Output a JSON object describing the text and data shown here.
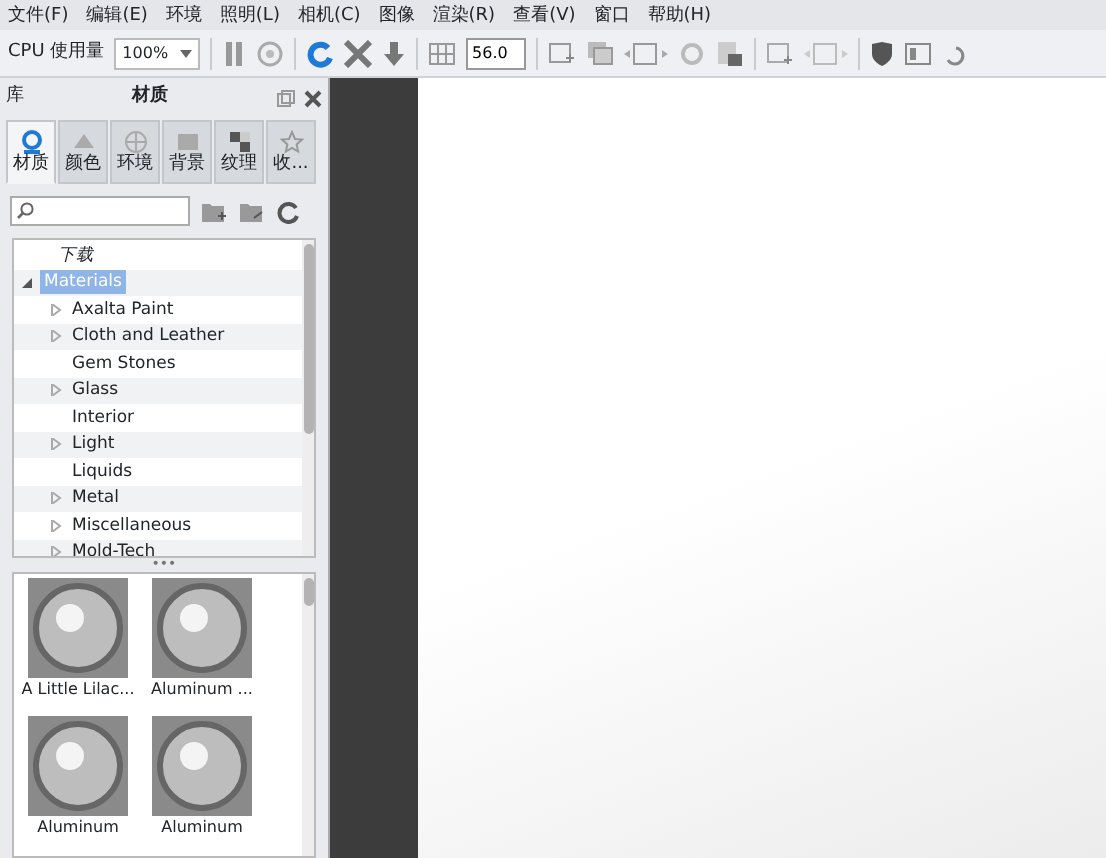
{
  "menu": [
    {
      "label": "文件(F)"
    },
    {
      "label": "编辑(E)"
    },
    {
      "label": "环境"
    },
    {
      "label": "照明(L)"
    },
    {
      "label": "相机(C)"
    },
    {
      "label": "图像"
    },
    {
      "label": "渲染(R)"
    },
    {
      "label": "查看(V)"
    },
    {
      "label": "窗口"
    },
    {
      "label": "帮助(H)"
    }
  ],
  "toolbar": {
    "cpu_label": "CPU 使用量",
    "cpu_select": "100%",
    "number_field": "56.0"
  },
  "panel": {
    "left_title": "库",
    "title": "材质",
    "tabs": [
      {
        "label": "材质",
        "selected": true
      },
      {
        "label": "颜色",
        "selected": false
      },
      {
        "label": "环境",
        "selected": false
      },
      {
        "label": "背景",
        "selected": false
      },
      {
        "label": "纹理",
        "selected": false
      },
      {
        "label": "收...",
        "selected": false
      }
    ],
    "tree": [
      {
        "label": "下载",
        "italic": true,
        "selected": false,
        "expandable": false
      },
      {
        "label": "Materials",
        "italic": false,
        "selected": true,
        "expandable": true,
        "expanded": true,
        "children": [
          {
            "label": "Axalta Paint",
            "expandable": true
          },
          {
            "label": "Cloth and Leather",
            "expandable": true
          },
          {
            "label": "Gem Stones",
            "expandable": false
          },
          {
            "label": "Glass",
            "expandable": true
          },
          {
            "label": "Interior",
            "expandable": false
          },
          {
            "label": "Light",
            "expandable": true
          },
          {
            "label": "Liquids",
            "expandable": false
          },
          {
            "label": "Metal",
            "expandable": true
          },
          {
            "label": "Miscellaneous",
            "expandable": true
          },
          {
            "label": "Mold-Tech",
            "expandable": true
          }
        ]
      }
    ],
    "splitter": "•••",
    "thumbnails": [
      {
        "label": "A Little Lilac..."
      },
      {
        "label": "Aluminum ..."
      },
      {
        "label": "Aluminum"
      },
      {
        "label": "Aluminum"
      }
    ]
  }
}
